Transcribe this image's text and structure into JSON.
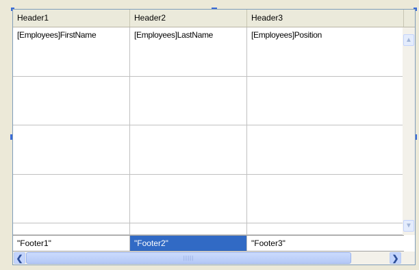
{
  "headers": [
    "Header1",
    "Header2",
    "Header3"
  ],
  "rows": [
    [
      "[Employees]FirstName",
      "[Employees]LastName",
      "[Employees]Position"
    ],
    [
      "",
      "",
      ""
    ],
    [
      "",
      "",
      ""
    ],
    [
      "",
      "",
      ""
    ],
    [
      "",
      "",
      ""
    ]
  ],
  "footers": [
    "\"Footer1\"",
    "\"Footer2\"",
    "\"Footer3\""
  ],
  "selected_footer": "\"Footer2\"",
  "colors": {
    "selection": "#316ac5",
    "frame": "#ece9d8",
    "handle": "#3a6bd6"
  },
  "icons": {
    "scroll_up": "chevron-up-icon",
    "scroll_down": "chevron-down-icon",
    "scroll_left": "chevron-left-icon",
    "scroll_right": "chevron-right-icon"
  }
}
